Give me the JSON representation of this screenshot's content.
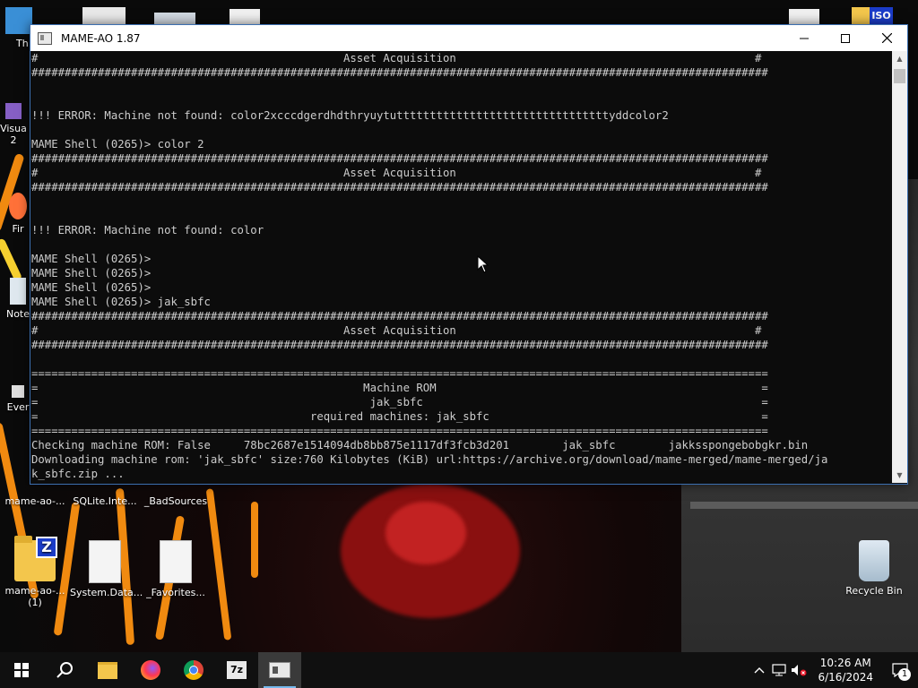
{
  "window": {
    "title": "MAME-AO 1.87",
    "minimize_icon": "minimize-icon",
    "maximize_icon": "maximize-icon",
    "close_icon": "close-icon"
  },
  "console": {
    "lines": [
      "#                                              Asset Acquisition                                             #",
      "###############################################################################################################",
      "",
      "",
      "!!! ERROR: Machine not found: color2xcccdgerdhdthryuytuttttttttttttttttttttttttttttttttyddcolor2",
      "",
      "MAME Shell (0265)> color 2",
      "###############################################################################################################",
      "#                                              Asset Acquisition                                             #",
      "###############################################################################################################",
      "",
      "",
      "!!! ERROR: Machine not found: color",
      "",
      "MAME Shell (0265)>",
      "MAME Shell (0265)>",
      "MAME Shell (0265)>",
      "MAME Shell (0265)> jak_sbfc",
      "###############################################################################################################",
      "#                                              Asset Acquisition                                             #",
      "###############################################################################################################",
      "",
      "===============================================================================================================",
      "=                                                 Machine ROM                                                 =",
      "=                                                  jak_sbfc                                                   =",
      "=                                         required machines: jak_sbfc                                         =",
      "===============================================================================================================",
      "Checking machine ROM: False     78bc2687e1514094db8bb875e1117df3fcb3d201        jak_sbfc        jakksspongebobgkr.bin",
      "Downloading machine rom: 'jak_sbfc' size:760 Kilobytes (KiB) url:https://archive.org/download/mame-merged/mame-merged/ja",
      "k_sbfc.zip ..."
    ]
  },
  "desktop": {
    "icons": [
      {
        "label": "Th",
        "icon": "blue-folder-icon"
      },
      {
        "label": "Visua",
        "icon": "visual-studio-icon"
      },
      {
        "label": "2",
        "icon": ""
      },
      {
        "label": "Fir",
        "icon": "firefox-icon"
      },
      {
        "label": "Note",
        "icon": "notepad-icon"
      },
      {
        "label": "Ever",
        "icon": "everything-icon"
      },
      {
        "label": "mame-ao-...",
        "icon": "folder-icon"
      },
      {
        "label": "SQLite.Inte...",
        "icon": "document-icon"
      },
      {
        "label": "_BadSources",
        "icon": "document-icon"
      },
      {
        "label": "mame-ao-...\n(1)",
        "icon": "zip-folder-icon"
      },
      {
        "label": "System.Data...",
        "icon": "settings-file-icon"
      },
      {
        "label": "_Favorites...",
        "icon": "document-icon"
      },
      {
        "label": "Recycle Bin",
        "icon": "recycle-bin-icon"
      }
    ]
  },
  "taskbar": {
    "buttons": [
      "start-icon",
      "search-icon",
      "file-explorer-icon",
      "firefox-icon",
      "chrome-icon",
      "7zip-icon",
      "console-app-icon"
    ],
    "sevenzip_label": "7z",
    "clock": {
      "time": "10:26 AM",
      "date": "6/16/2024"
    },
    "notification_count": "1"
  }
}
